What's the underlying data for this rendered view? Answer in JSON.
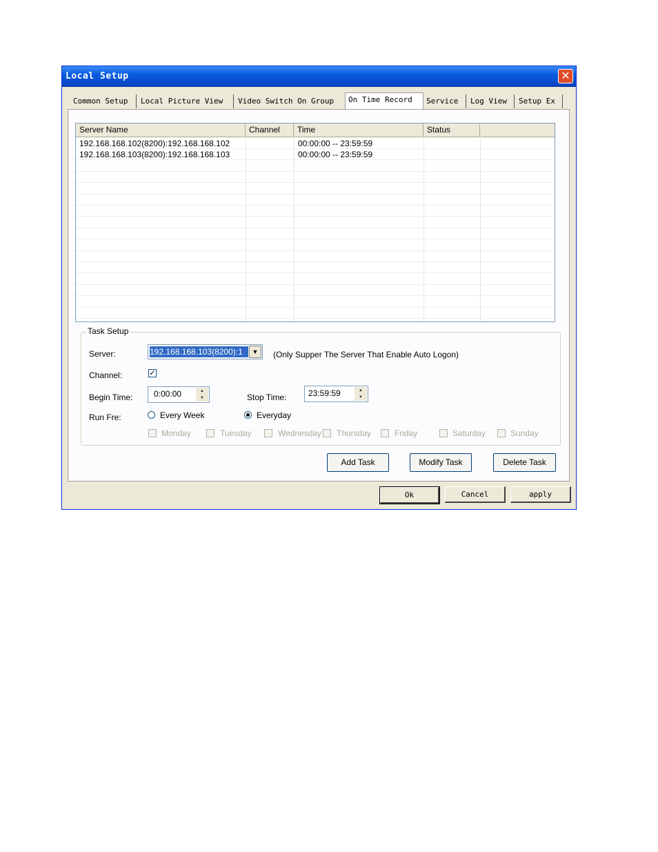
{
  "window": {
    "title": "Local Setup"
  },
  "tabs": [
    {
      "label": "Common Setup"
    },
    {
      "label": "Local Picture View"
    },
    {
      "label": "Video Switch On Group"
    },
    {
      "label": "On Time Record"
    },
    {
      "label": "Service"
    },
    {
      "label": "Log View"
    },
    {
      "label": "Setup Ex"
    }
  ],
  "active_tab": "On Time Record",
  "list": {
    "columns": [
      "Server Name",
      "Channel",
      "Time",
      "Status",
      ""
    ],
    "rows": [
      {
        "server": "192.168.168.102(8200):192.168.168.102",
        "channel": "",
        "time": "00:00:00 -- 23:59:59",
        "status": ""
      },
      {
        "server": "192.168.168.103(8200):192.168.168.103",
        "channel": "",
        "time": "00:00:00 -- 23:59:59",
        "status": ""
      }
    ]
  },
  "task_setup": {
    "legend": "Task Setup",
    "server_label": "Server:",
    "server_value": "192.168.168.103(8200):1",
    "server_hint": "(Only Supper The Server That Enable Auto Logon)",
    "channel_label": "Channel:",
    "channel_checked": true,
    "begin_label": "Begin Time:",
    "begin_value": "0:00:00",
    "stop_label": "Stop Time:",
    "stop_value": "23:59:59",
    "run_label": "Run Fre:",
    "run_options": [
      {
        "label": "Every Week",
        "selected": false
      },
      {
        "label": "Everyday",
        "selected": true
      }
    ],
    "days": [
      "Monday",
      "Tuesday",
      "Wednesday",
      "Thursday",
      "Friday",
      "Saturday",
      "Sunday"
    ]
  },
  "actions": {
    "add": "Add Task",
    "modify": "Modify Task",
    "delete": "Delete Task"
  },
  "footer": {
    "ok": "Ok",
    "cancel": "Cancel",
    "apply": "apply"
  }
}
